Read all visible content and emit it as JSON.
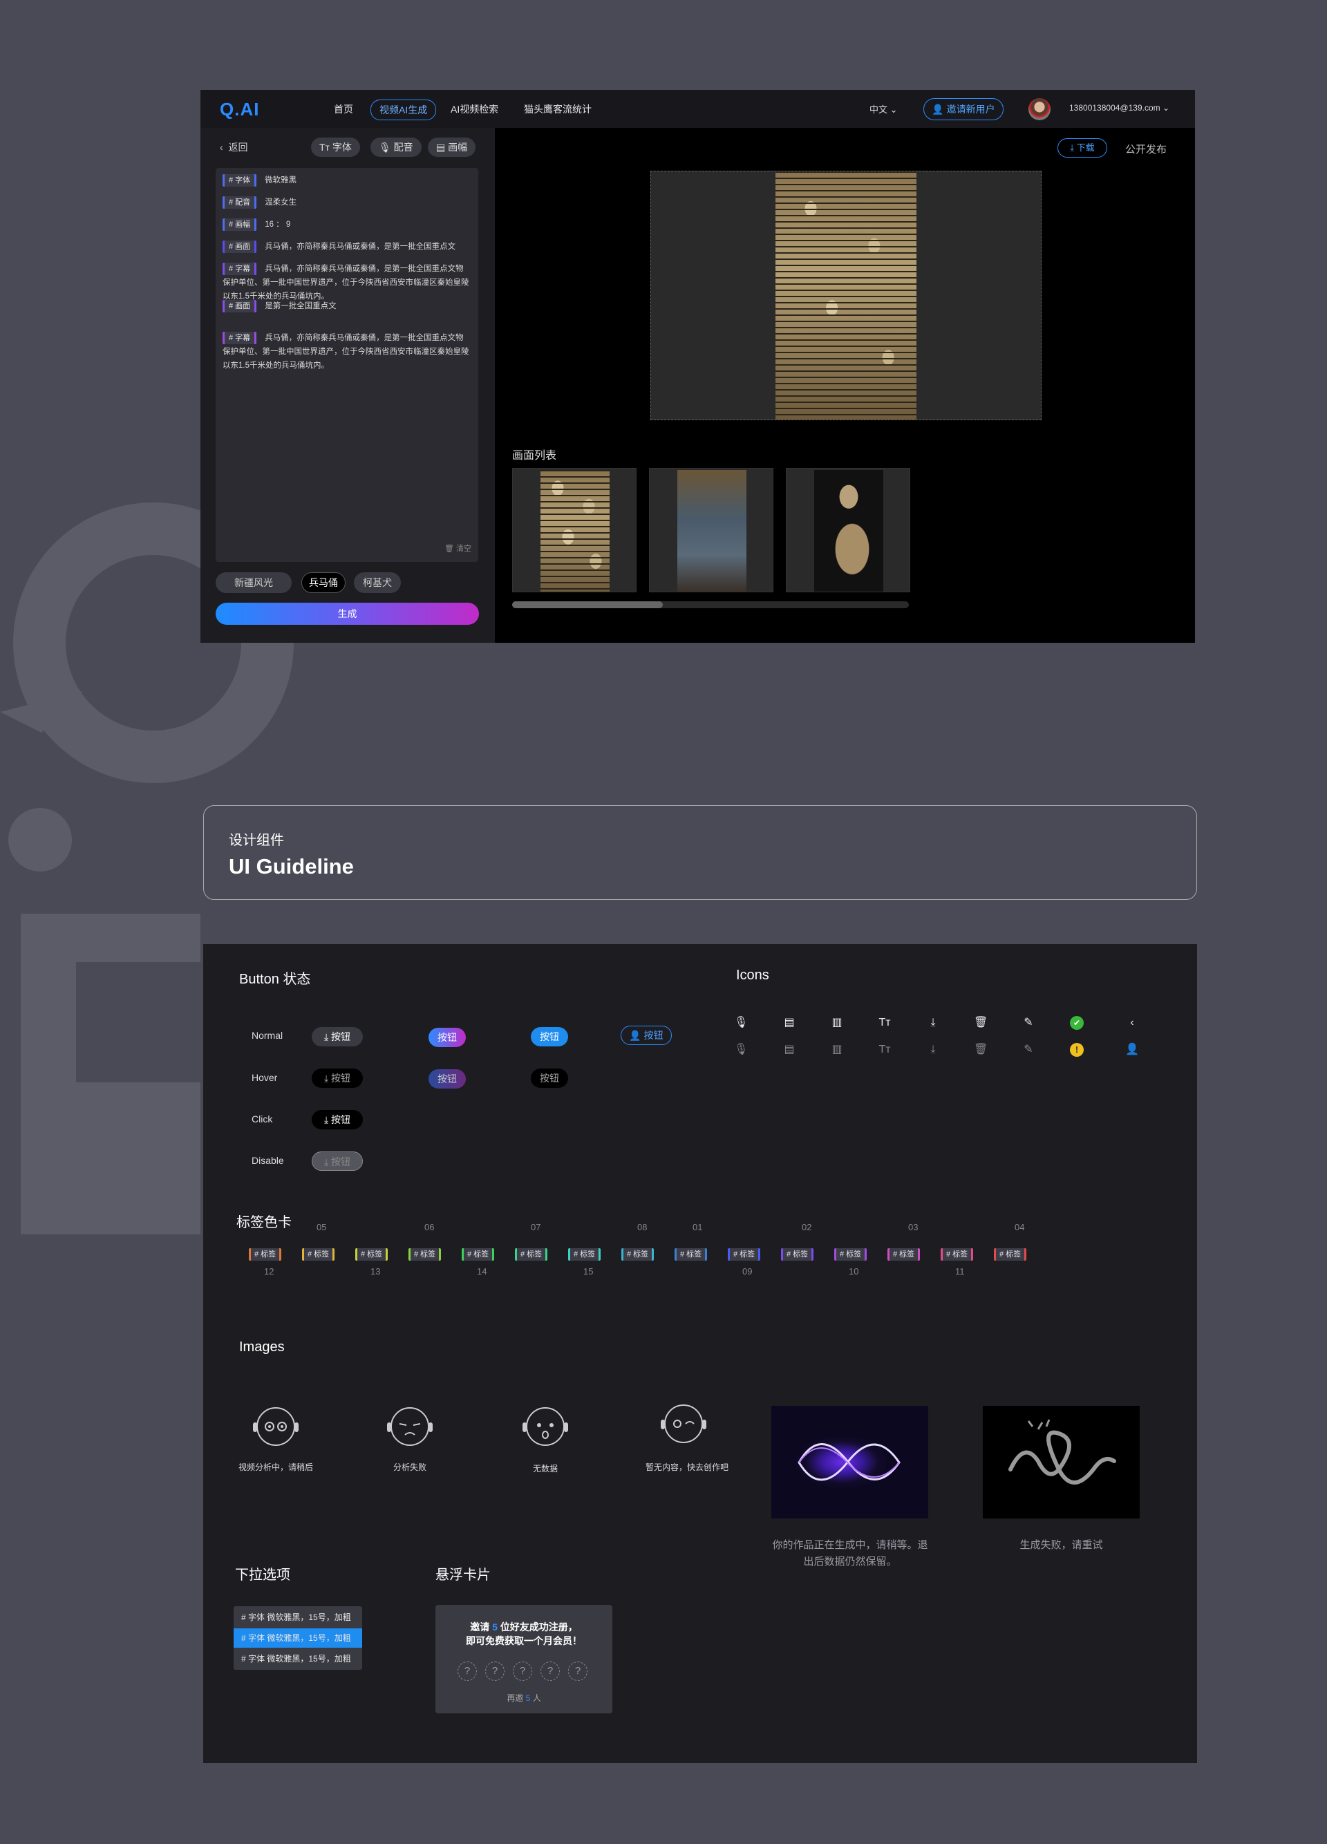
{
  "app": {
    "logo": "Q.AI",
    "nav": [
      "首页",
      "视频AI生成",
      "AI视频检索",
      "猫头鹰客流统计"
    ],
    "language": "中文",
    "invite_label": "邀请新用户",
    "user_email": "13800138004@139.com"
  },
  "editor": {
    "back_label": "返回",
    "toolbar": {
      "font": "字体",
      "dub": "配音",
      "frame": "画幅"
    },
    "script_rows": [
      {
        "tag": "# 字体",
        "text": "微软雅黑",
        "color": "#4c6ef5"
      },
      {
        "tag": "# 配音",
        "text": "温柔女生",
        "color": "#4c6ef5"
      },
      {
        "tag": "# 画幅",
        "text": "16 ： 9",
        "color": "#4c6ef5"
      },
      {
        "tag": "# 画面",
        "text": "兵马俑，亦简称秦兵马俑或秦俑，是第一批全国重点文",
        "color": "#5b4cf0"
      },
      {
        "tag": "# 字幕",
        "text": "兵马俑，亦简称秦兵马俑或秦俑，是第一批全国重点文物保护单位、第一批中国世界遗产，位于今陕西省西安市临潼区秦始皇陵以东1.5千米处的兵马俑坑内。",
        "color": "#7c4cf0"
      },
      {
        "tag": "# 画面",
        "text": "是第一批全国重点文",
        "color": "#8a4cf0"
      },
      {
        "tag": "# 字幕",
        "text": "兵马俑，亦简称秦兵马俑或秦俑，是第一批全国重点文物保护单位、第一批中国世界遗产，位于今陕西省西安市临潼区秦始皇陵以东1.5千米处的兵马俑坑内。",
        "color": "#9a4ce0"
      }
    ],
    "clear_label": "清空",
    "chips": [
      "新疆风光",
      "兵马俑",
      "柯基犬"
    ],
    "generate_label": "生成",
    "download_label": "下载",
    "publish_label": "公开发布",
    "picture_list_label": "画面列表",
    "scroll_position": 0.38
  },
  "guideline": {
    "subtitle": "设计组件",
    "title": "UI Guideline"
  },
  "components": {
    "button_title": "Button 状态",
    "icons_title": "Icons",
    "states": [
      "Normal",
      "Hover",
      "Click",
      "Disable"
    ],
    "button_label": "按钮",
    "icon_rows": [
      [
        "mic-icon",
        "document-icon",
        "document-lines-icon",
        "font-icon",
        "download-icon",
        "trash-icon",
        "pen-icon",
        "success-icon",
        "chevron-left-icon"
      ],
      [
        "mic-icon",
        "document-icon",
        "document-lines-icon",
        "font-icon",
        "download-icon",
        "trash-icon",
        "pen-icon",
        "warning-icon",
        "user-icon"
      ]
    ],
    "tag_title": "标签色卡",
    "tag_label": "# 标签",
    "tag_numbers_top": [
      "05",
      "06",
      "07",
      "08",
      "01",
      "02",
      "03",
      "04"
    ],
    "tag_numbers_bottom": [
      "12",
      "13",
      "14",
      "15",
      "09",
      "10",
      "11"
    ],
    "tag_colors": [
      "#e0763a",
      "#e0b43a",
      "#c8d23a",
      "#8ad23a",
      "#3ad25a",
      "#3ad28a",
      "#3ad2c0",
      "#3ab4d2",
      "#3a82d2",
      "#4a5cf0",
      "#7a4cf0",
      "#a04ce0",
      "#d04cc0",
      "#e04c8a",
      "#e04c4c"
    ],
    "images_title": "Images",
    "robot_captions": [
      "视频分析中，请稍后",
      "分析失败",
      "无数据",
      "暂无内容，快去创作吧"
    ],
    "wave_caption": "你的作品正在生成中，请稍等。退出后数据仍然保留。",
    "fail_caption": "生成失败，请重试",
    "dropdown_title": "下拉选项",
    "dropdown_items": [
      "# 字体  微软雅黑，15号，加粗",
      "# 字体  微软雅黑，15号，加粗",
      "# 字体  微软雅黑，15号，加粗"
    ],
    "hover_title": "悬浮卡片",
    "card_text": "邀请",
    "card_count": "5",
    "card_text2": "位好友成功注册，",
    "card_text3": "即可免费获取一个月会员！",
    "card_foot": "再邀",
    "card_foot_count": "5",
    "card_foot_unit": "人"
  }
}
